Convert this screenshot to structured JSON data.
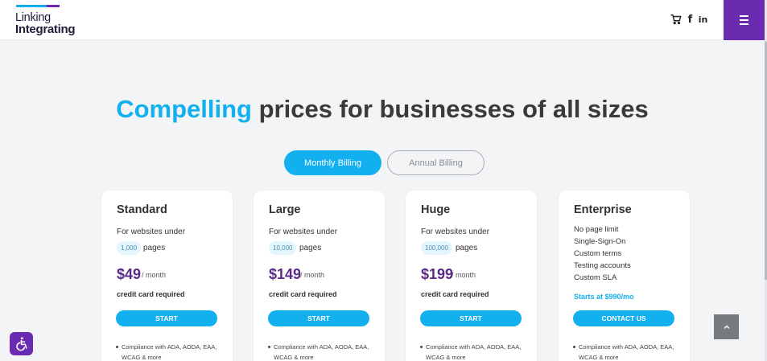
{
  "header": {
    "logo_line1": "Linking",
    "logo_line2": "Integrating",
    "facebook_glyph": "f",
    "linkedin_glyph": "in",
    "icons": [
      "cart-icon",
      "facebook-icon",
      "linkedin-icon",
      "hamburger-menu-icon"
    ]
  },
  "hero": {
    "headline_accent": "Compelling",
    "headline_rest": " prices for businesses of all sizes"
  },
  "billing": {
    "monthly_label": "Monthly Billing",
    "annual_label": "Annual Billing"
  },
  "plans": [
    {
      "name": "Standard",
      "subtitle": "For websites under",
      "page_count": "1,000",
      "pages_label": "pages",
      "price": "$49",
      "per": "/ month",
      "cc_note": "credit card required",
      "button": "START",
      "feature": "Compliance with ADA, AODA, EAA, WCAG & more"
    },
    {
      "name": "Large",
      "subtitle": "For websites under",
      "page_count": "10,000",
      "pages_label": "pages",
      "price": "$149",
      "per": "/ month",
      "cc_note": "credit card required",
      "button": "START",
      "feature": "Compliance with ADA, AODA, EAA, WCAG & more"
    },
    {
      "name": "Huge",
      "subtitle": "For websites under",
      "page_count": "100,000",
      "pages_label": "pages",
      "price": "$199",
      "per": "/ month",
      "cc_note": "credit card required",
      "button": "START",
      "feature": "Compliance with ADA, AODA, EAA, WCAG & more"
    },
    {
      "name": "Enterprise",
      "items": [
        "No page limit",
        "Single-Sign-On",
        "Custom terms",
        "Testing accounts",
        "Custom SLA"
      ],
      "starts_at": "Starts at $990/mo",
      "button": "CONTACT US",
      "feature": "Compliance with ADA, AODA, EAA, WCAG & more"
    }
  ],
  "colors": {
    "accent_blue": "#12b0ee",
    "brand_purple": "#6a2bb0",
    "price_purple": "#5b2a86",
    "page_background": "#f2f4f6"
  },
  "floating": {
    "accessibility_icon": "accessibility-icon",
    "scroll_top_icon": "chevron-up-icon"
  }
}
